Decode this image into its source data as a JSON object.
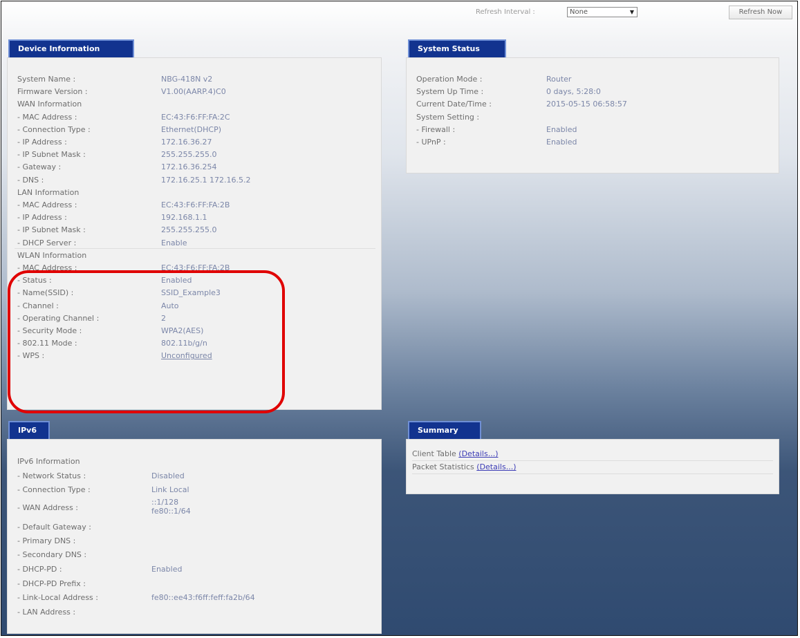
{
  "topbar": {
    "refresh_interval_label": "Refresh Interval :",
    "refresh_interval_value": "None",
    "refresh_button": "Refresh Now"
  },
  "device_info": {
    "title": "Device Information",
    "rows": [
      {
        "label": "System Name :",
        "value": ""
      },
      {
        "label": "Firmware Version :",
        "value": ""
      },
      {
        "label": "WAN Information",
        "value": ""
      },
      {
        "label": "- MAC Address :",
        "value": ""
      },
      {
        "label": "- Connection Type :",
        "value": ""
      },
      {
        "label": "- IP Address :",
        "value": ""
      },
      {
        "label": "- IP Subnet Mask :",
        "value": ""
      },
      {
        "label": "- Gateway :",
        "value": ""
      },
      {
        "label": "- DNS :",
        "value": ""
      },
      {
        "label": "LAN Information",
        "value": ""
      },
      {
        "label": "- MAC Address :",
        "value": ""
      },
      {
        "label": "- IP Address :",
        "value": ""
      },
      {
        "label": "- IP Subnet Mask :",
        "value": ""
      },
      {
        "label": "- DHCP Server :",
        "value": ""
      },
      {
        "label": "WLAN Information",
        "value": ""
      },
      {
        "label": "- MAC Address :",
        "value": ""
      },
      {
        "label": "- Status :",
        "value": ""
      },
      {
        "label": "- Name(SSID) :",
        "value": ""
      },
      {
        "label": "- Channel :",
        "value": ""
      },
      {
        "label": "- Operating Channel :",
        "value": ""
      },
      {
        "label": "- Security Mode :",
        "value": ""
      },
      {
        "label": "- 802.11 Mode :",
        "value": ""
      },
      {
        "label": "- WPS :",
        "value": ""
      }
    ],
    "values": [
      "NBG-418N v2",
      "V1.00(AARP.4)C0",
      "",
      "EC:43:F6:FF:FA:2C",
      "Ethernet(DHCP)",
      "172.16.36.27",
      "255.255.255.0",
      "172.16.36.254",
      "172.16.25.1 172.16.5.2",
      "",
      "EC:43:F6:FF:FA:2B",
      "192.168.1.1",
      "255.255.255.0",
      "Enable",
      "",
      "EC:43:F6:FF:FA:2B",
      "Enabled",
      "SSID_Example3",
      "Auto",
      "2",
      "WPA2(AES)",
      "802.11b/g/n",
      "Unconfigured"
    ]
  },
  "system_status": {
    "title": "System Status",
    "rows": [
      {
        "label": "Operation Mode :",
        "value": "Router"
      },
      {
        "label": "System Up Time :",
        "value": "0 days, 5:28:0"
      },
      {
        "label": "Current Date/Time :",
        "value": "2015-05-15 06:58:57"
      },
      {
        "label": "System Setting :",
        "value": ""
      },
      {
        "label": "- Firewall :",
        "value": "Enabled"
      },
      {
        "label": "- UPnP :",
        "value": "Enabled"
      }
    ]
  },
  "ipv6": {
    "title": "IPv6",
    "rows": [
      {
        "label": "IPv6 Information",
        "value": ""
      },
      {
        "label": "- Network Status :",
        "value": "Disabled"
      },
      {
        "label": "- Connection Type :",
        "value": "Link Local"
      },
      {
        "label": "- WAN Address :",
        "value": "::1/128"
      },
      {
        "label": "- Default Gateway :",
        "value": ""
      },
      {
        "label": "- Primary DNS :",
        "value": ""
      },
      {
        "label": "- Secondary DNS :",
        "value": ""
      },
      {
        "label": "- DHCP-PD :",
        "value": "Enabled"
      },
      {
        "label": "- DHCP-PD Prefix :",
        "value": ""
      },
      {
        "label": "- Link-Local Address :",
        "value": "fe80::ee43:f6ff:feff:fa2b/64"
      },
      {
        "label": "- LAN Address :",
        "value": ""
      }
    ],
    "wan_address_line2": "fe80::1/64"
  },
  "summary": {
    "title": "Summary",
    "client_table_label": "Client Table",
    "client_table_link": "(Details...)",
    "packet_stats_label": "Packet Statistics",
    "packet_stats_link": "(Details...)"
  }
}
